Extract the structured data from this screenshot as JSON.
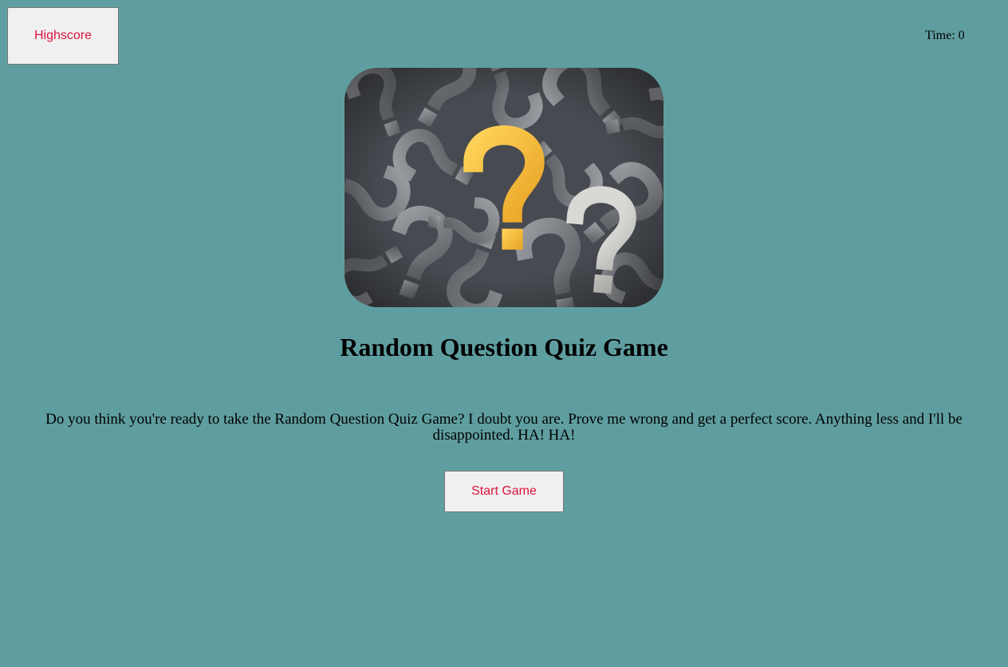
{
  "header": {
    "highscore_label": "Highscore",
    "time_label": "Time:",
    "time_value": "0"
  },
  "main": {
    "title": "Random Question Quiz Game",
    "intro": "Do you think you're ready to take the Random Question Quiz Game? I doubt you are. Prove me wrong and get a perfect score. Anything less and I'll be disappointed. HA! HA!",
    "start_label": "Start Game"
  },
  "colors": {
    "background": "#5f9ea0",
    "button_text": "#dc143c",
    "button_bg": "#f0f0f0",
    "accent_question_mark": "#f7bf3c"
  }
}
